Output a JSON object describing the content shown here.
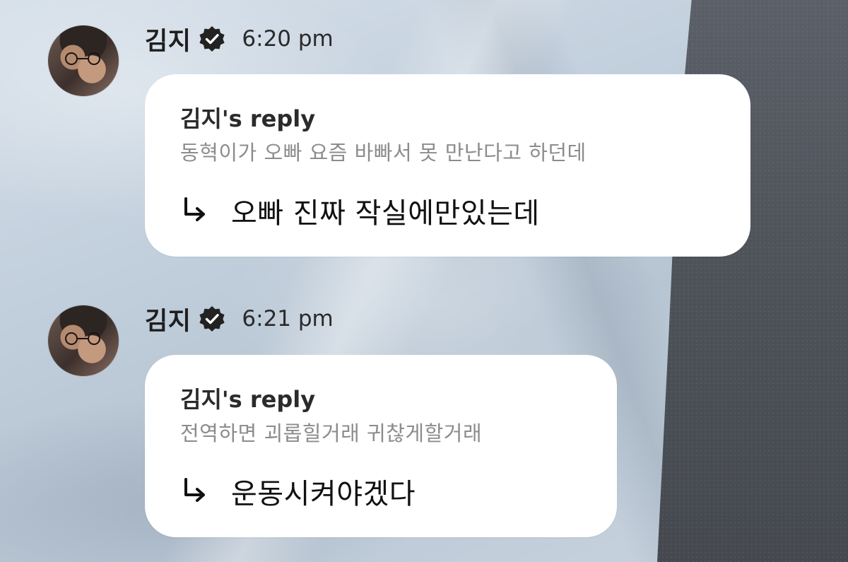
{
  "messages": [
    {
      "username": "김지",
      "timestamp": "6:20 pm",
      "avatar_icon": "avatar-face-palm",
      "verified_icon": "verified-badge-icon",
      "reply_label": "김지's reply",
      "quoted_text": "동혁이가 오빠 요즘 바빠서 못 만난다고 하던데",
      "reply_icon": "reply-arrow-icon",
      "reply_text": "오빠 진짜 작실에만있는데"
    },
    {
      "username": "김지",
      "timestamp": "6:21 pm",
      "avatar_icon": "avatar-face-palm",
      "verified_icon": "verified-badge-icon",
      "reply_label": "김지's reply",
      "quoted_text": "전역하면 괴롭힐거래 귀찮게할거래",
      "reply_icon": "reply-arrow-icon",
      "reply_text": "운동시켜야겠다"
    }
  ],
  "colors": {
    "bubble": "#ffffff",
    "text_primary": "#111111",
    "text_quoted": "#8c8c8c",
    "verified_badge": "#222222"
  }
}
